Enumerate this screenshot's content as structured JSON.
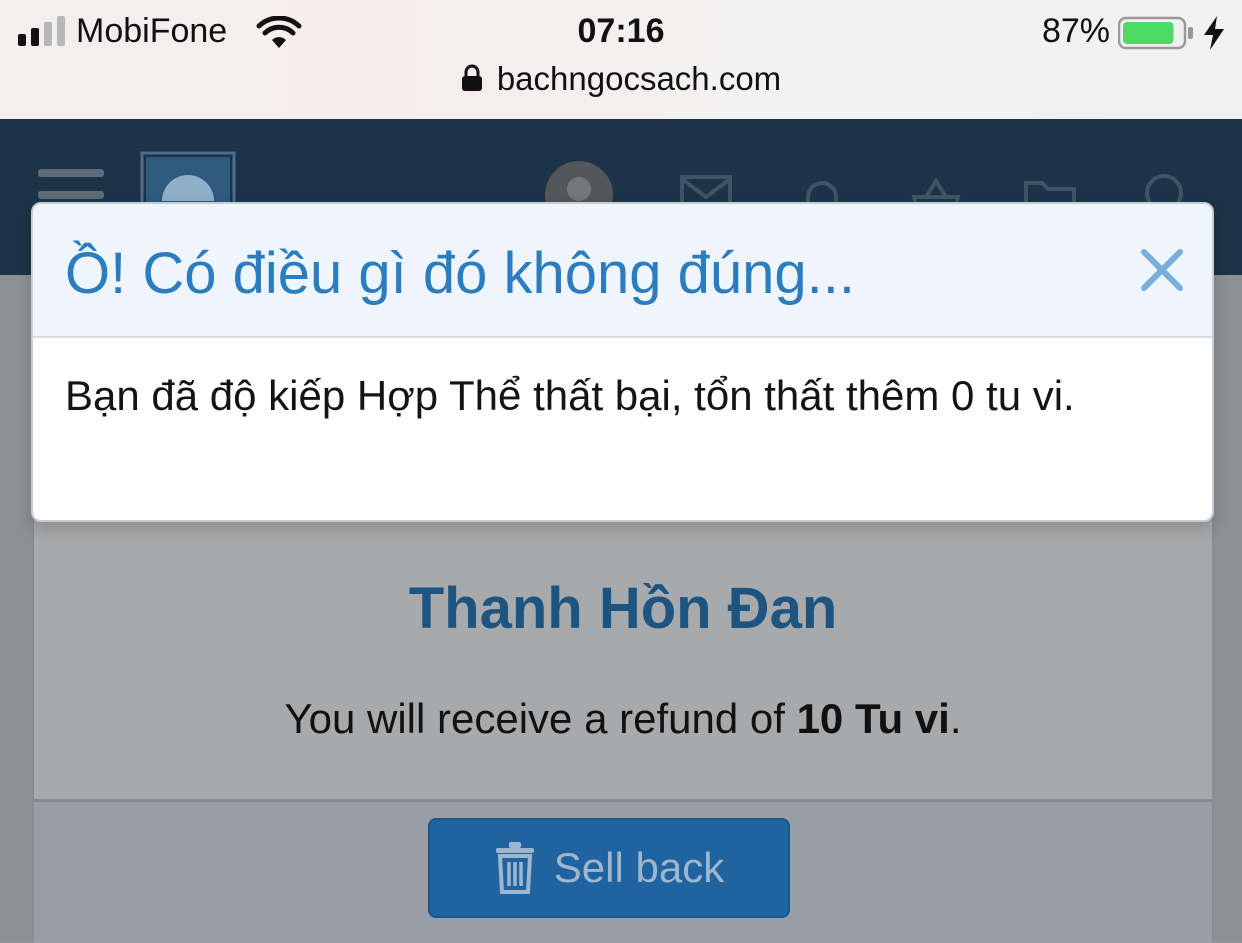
{
  "status_bar": {
    "carrier": "MobiFone",
    "time": "07:16",
    "battery_percent": "87%",
    "battery_level": 0.87,
    "charging": true,
    "url": "bachngocsach.com"
  },
  "header": {
    "icons": [
      "menu-icon",
      "site-logo",
      "avatar",
      "mail-icon",
      "bell-icon",
      "basket-icon",
      "folder-icon",
      "search-icon"
    ]
  },
  "modal": {
    "title": "Ồ! Có điều gì đó không đúng...",
    "message": "Bạn đã độ kiếp Hợp Thể thất bại, tổn thất thêm 0 tu vi.",
    "close_icon": "close-icon"
  },
  "card": {
    "product_name": "Thanh Hồn Đan",
    "refund_prefix": "You will receive a refund of ",
    "refund_amount": "10 Tu vi",
    "refund_suffix": ".",
    "sell_button": "Sell back"
  },
  "colors": {
    "modal_title": "#2b7dbf",
    "product_title": "#1e5480",
    "button": "#1f64a0",
    "header": "#1d3448"
  }
}
